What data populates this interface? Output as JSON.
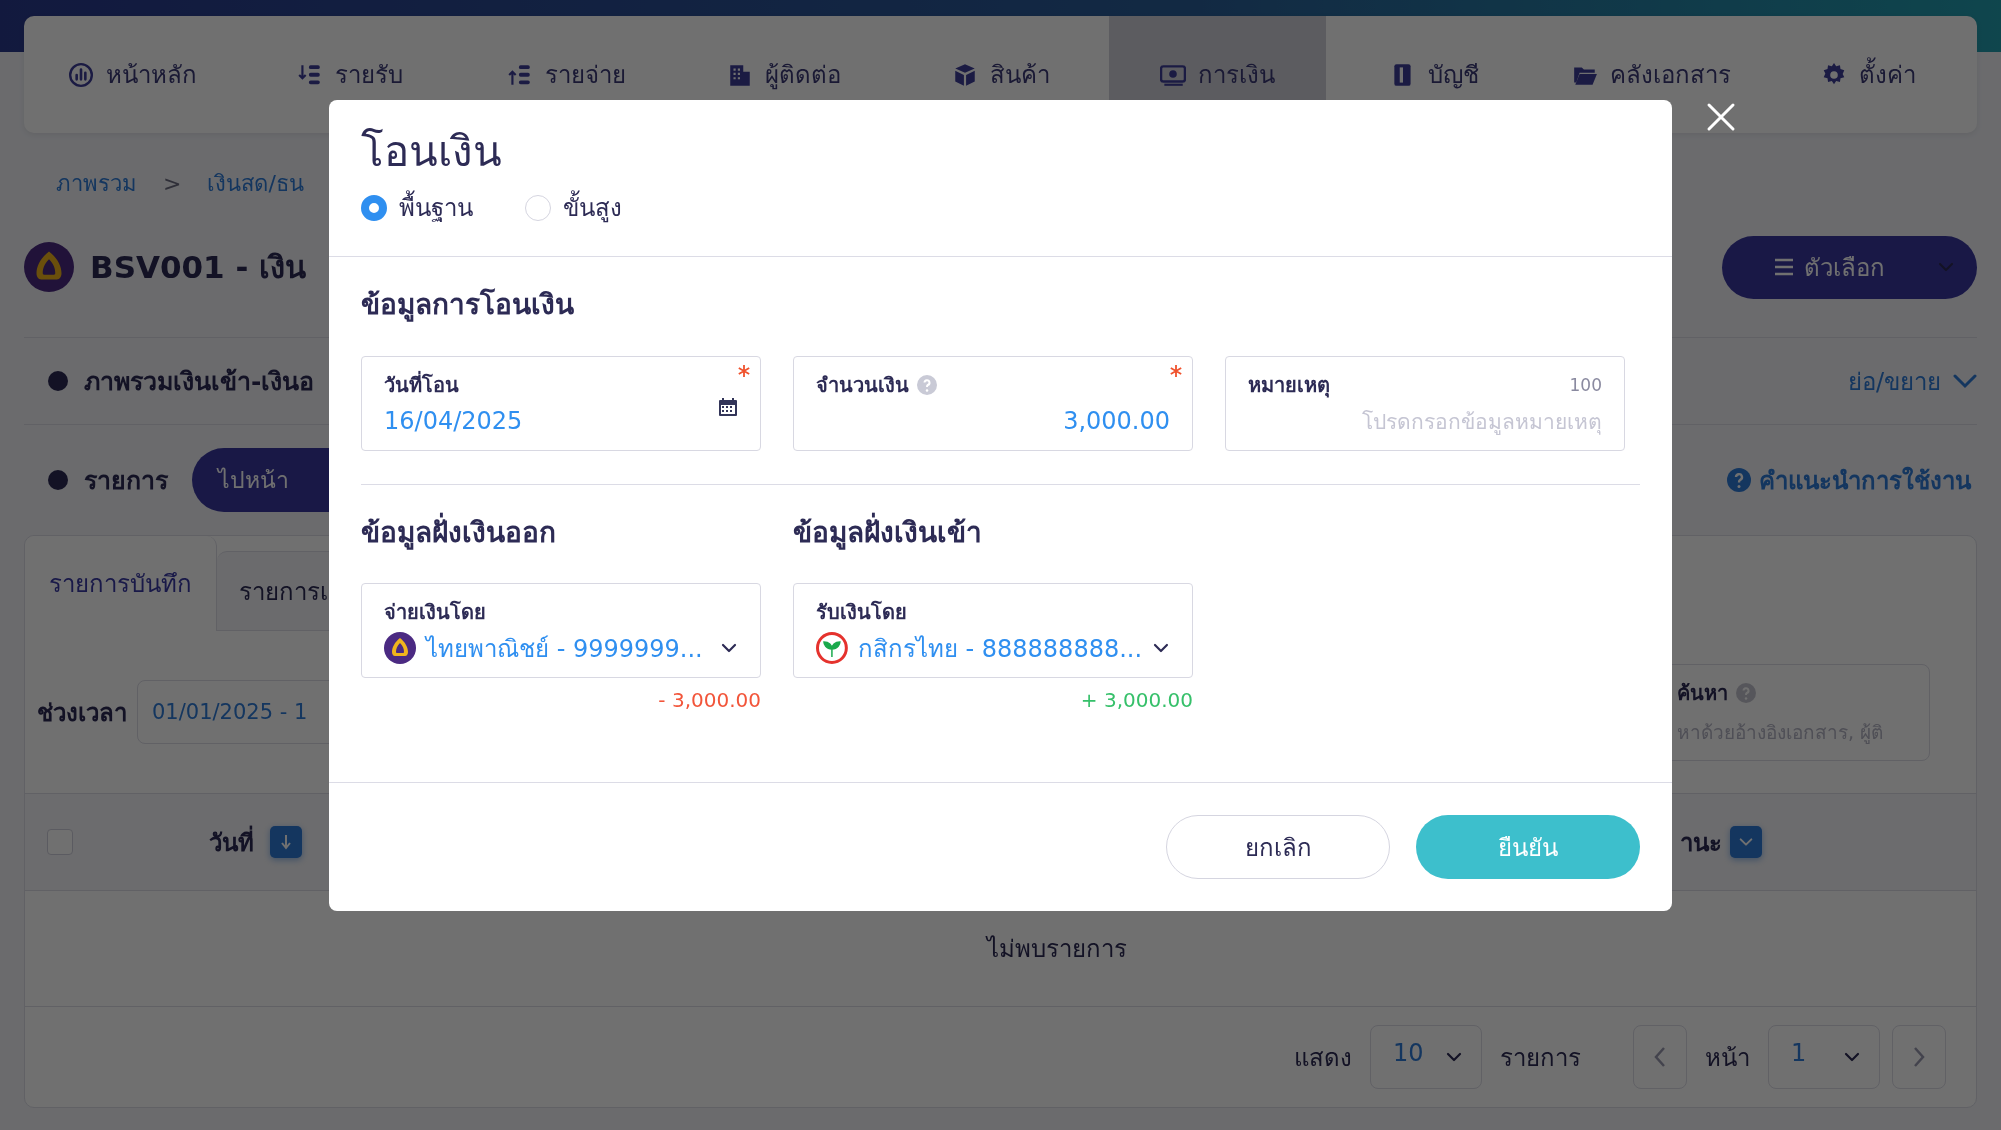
{
  "nav": {
    "tabs": [
      {
        "label": "หน้าหลัก",
        "selected": false
      },
      {
        "label": "รายรับ",
        "selected": false
      },
      {
        "label": "รายจ่าย",
        "selected": false
      },
      {
        "label": "ผู้ติดต่อ",
        "selected": false
      },
      {
        "label": "สินค้า",
        "selected": false
      },
      {
        "label": "การเงิน",
        "selected": true
      },
      {
        "label": "บัญชี",
        "selected": false
      },
      {
        "label": "คลังเอกสาร",
        "selected": false
      },
      {
        "label": "ตั้งค่า",
        "selected": false
      }
    ]
  },
  "breadcrumb": [
    "ภาพรวม",
    ">",
    "เงินสด/ธน"
  ],
  "account": {
    "title": "BSV001 - เงิน",
    "options_button": "ตัวเลือก"
  },
  "overview_section": {
    "title": "ภาพรวมเงินเข้า-เงินอ",
    "toggle": "ย่อ/ขยาย"
  },
  "list_section": {
    "title": "รายการ",
    "button": "ไปหน้า",
    "help": "คำแนะนำการใช้งาน"
  },
  "tabs": [
    {
      "label": "รายการบันทึก",
      "selected": true
    },
    {
      "label": "รายการเ",
      "selected": false
    }
  ],
  "filters": {
    "period_label": "ช่วงเวลา",
    "period_value": "01/01/2025 - 1",
    "search_label": "ค้นหา",
    "search_placeholder": "หาด้วยอ้างอิงเอกสาร, ผู้ติ"
  },
  "table": {
    "select_all_checked": false,
    "columns": [
      "วันที่",
      "านะ"
    ],
    "empty_text": "ไม่พบรายการ"
  },
  "pagination": {
    "show_label": "แสดง",
    "page_size": "10",
    "rows_label": "รายการ",
    "page_label": "หน้า",
    "page": "1"
  },
  "dialog": {
    "title": "โอนเงิน",
    "modes": [
      {
        "label": "พื้นฐาน",
        "selected": true
      },
      {
        "label": "ขั้นสูง",
        "selected": false
      }
    ],
    "transfer_section": "ข้อมูลการโอนเงิน",
    "fields": [
      {
        "kind": "date",
        "label": "วันที่โอน",
        "value": "16/04/2025",
        "required": true
      },
      {
        "kind": "amount",
        "label": "จำนวนเงิน",
        "value": "3,000.00",
        "required": true
      },
      {
        "kind": "note",
        "label": "หมายเหตุ",
        "counter": "100",
        "placeholder": "โปรดกรอกข้อมูลหมายเหตุ",
        "required": false
      }
    ],
    "sides": [
      {
        "kind": "out",
        "title": "ข้อมูลฝั่งเงินออก",
        "label": "จ่ายเงินโดย",
        "value": "ไทยพาณิชย์ - 9999999...",
        "amount": "- 3,000.00"
      },
      {
        "kind": "in",
        "title": "ข้อมูลฝั่งเงินเข้า",
        "label": "รับเงินโดย",
        "value": "กสิกรไทย - 888888888...",
        "amount": "+ 3,000.00"
      }
    ],
    "buttons": [
      {
        "kind": "cancel",
        "label": "ยกเลิก"
      },
      {
        "kind": "confirm",
        "label": "ยืนยัน"
      }
    ]
  }
}
